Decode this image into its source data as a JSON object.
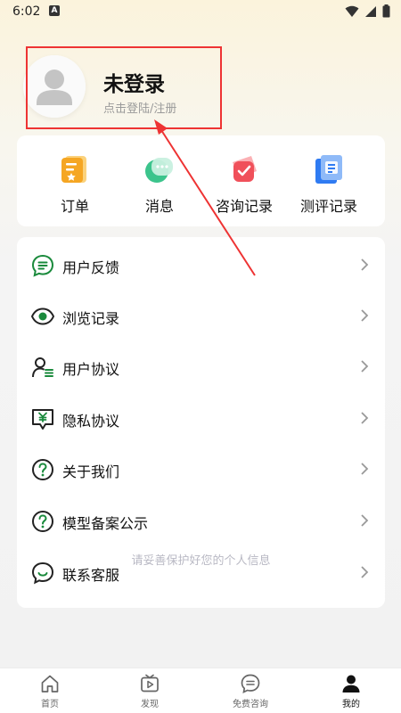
{
  "status_bar": {
    "time": "6:02",
    "notification_badge": "A"
  },
  "profile": {
    "title": "未登录",
    "subtitle": "点击登陆/注册"
  },
  "quick_actions": [
    {
      "label": "订单",
      "icon": "order-icon",
      "color": "#f5a623"
    },
    {
      "label": "消息",
      "icon": "message-icon",
      "color": "#3cc48c"
    },
    {
      "label": "咨询记录",
      "icon": "consult-record-icon",
      "color": "#f0505a"
    },
    {
      "label": "测评记录",
      "icon": "assessment-record-icon",
      "color": "#2f7bf2"
    }
  ],
  "menu": [
    {
      "label": "用户反馈",
      "icon": "feedback-icon"
    },
    {
      "label": "浏览记录",
      "icon": "eye-icon"
    },
    {
      "label": "用户协议",
      "icon": "user-agreement-icon"
    },
    {
      "label": "隐私协议",
      "icon": "privacy-icon"
    },
    {
      "label": "关于我们",
      "icon": "about-icon"
    },
    {
      "label": "模型备案公示",
      "icon": "model-filing-icon"
    },
    {
      "label": "联系客服",
      "icon": "customer-service-icon"
    }
  ],
  "privacy_hint": "请妥善保护好您的个人信息",
  "bottom_nav": [
    {
      "label": "首页",
      "icon": "home-icon",
      "active": false
    },
    {
      "label": "发现",
      "icon": "discover-icon",
      "active": false
    },
    {
      "label": "免费咨询",
      "icon": "chat-icon",
      "active": false
    },
    {
      "label": "我的",
      "icon": "person-icon",
      "active": true
    }
  ],
  "colors": {
    "accent_green": "#1a8a3c",
    "annotation_red": "#e33333"
  }
}
